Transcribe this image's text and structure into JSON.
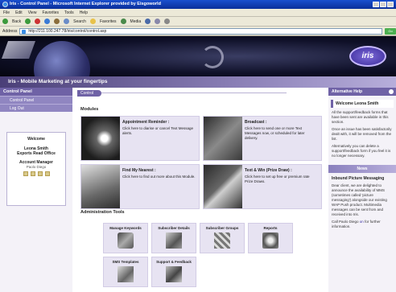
{
  "browser": {
    "title": "Iris - Control Panel - Microsoft Internet Explorer provided by Eisgoworld",
    "menu": [
      "File",
      "Edit",
      "View",
      "Favorites",
      "Tools",
      "Help"
    ],
    "toolbar": [
      "Back",
      "Search",
      "Favorites",
      "Media"
    ],
    "address_label": "Address",
    "address_value": "http://211.100.247.78/iris/control/control.asp",
    "go_label": "Go"
  },
  "banner": {
    "logo": "iris"
  },
  "tagline": "Iris - Mobile Marketing at your fingertips",
  "left_nav": {
    "header": "Control Panel",
    "items": [
      "Control Panel",
      "Log Out"
    ],
    "welcome_title": "Welcome",
    "user_name": "Leona Smith",
    "company": "Exports Read Office",
    "role_title": "Account Manager",
    "role_sub": "Paolo Diego"
  },
  "main": {
    "tab_label": "Control",
    "modules_title": "Modules",
    "modules": [
      {
        "title": "Appointment Reminder :",
        "desc": "Click here to diarise or cancel Text Message alerts."
      },
      {
        "title": "Broadcast :",
        "desc": "Click here to send one or more Text Messages now, or scheduled for later delivery."
      },
      {
        "title": "Find My Nearest :",
        "desc": "Click here to find out more about this Module."
      },
      {
        "title": "Text & Win (Prize Draw) :",
        "desc": "Click here to set up free or premium rate Prize Draws."
      }
    ],
    "admin_title": "Administration Tools",
    "admin_tools": [
      "Manage Keywords",
      "Subscriber Details",
      "Subscriber Groups",
      "Reports",
      "SMS Templates",
      "Support & Feedback"
    ]
  },
  "right_panel": {
    "help_header": "Alternative Help",
    "welcome": "Welcome Leona Smith",
    "help_text_1": "All the support/feedback forms that have been sent are available in this section.",
    "help_text_2": "Once an issue has been satisfactorily dealt with, it will be removed from the list.",
    "help_text_3": "Alternatively you can delete a support/feedback form if you feel it is no longer necessary.",
    "news_header": "News",
    "news_title": "Inbound Picture Messaging",
    "news_text": "Dear client, we are delighted to announce the availability of MMS (sometimes called 'picture messaging') alongside our existing WAP Push product. Multimedia messages can be sent from and received into Iris.",
    "news_call": "Call Paolo Diego",
    "news_call_link": "on",
    "news_call_tail": "for further information."
  }
}
